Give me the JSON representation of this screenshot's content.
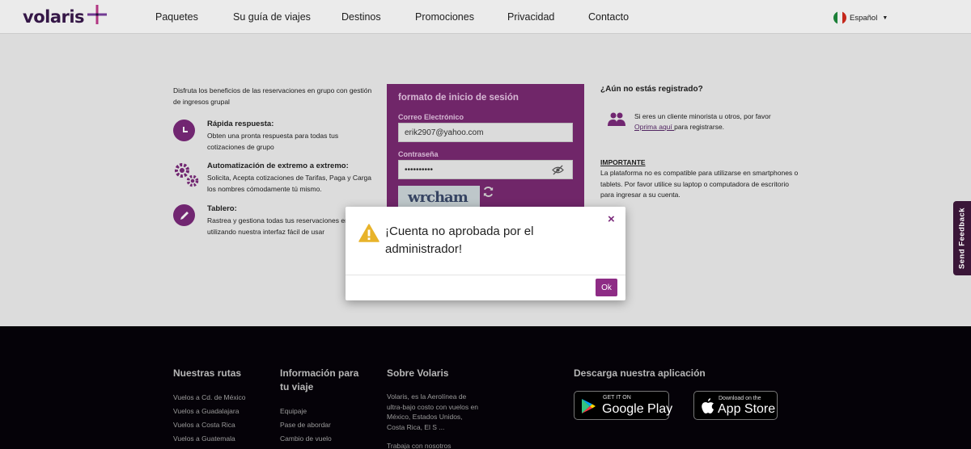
{
  "header": {
    "logo_text": "volaris",
    "nav": [
      "Paquetes",
      "Su guía de viajes",
      "Destinos",
      "Promociones",
      "Privacidad",
      "Contacto"
    ],
    "language": "Español"
  },
  "left": {
    "intro": "Disfruta los beneficios de las reservaciones en grupo con gestión de ingresos grupal",
    "benefits": [
      {
        "title": "Rápida respuesta:",
        "text": "Obten una pronta respuesta para todas tus cotizaciones de grupo",
        "icon": "clock-icon"
      },
      {
        "title": "Automatización de extremo a extremo:",
        "text": "Solicita, Acepta cotizaciones de Tarifas, Paga y Carga los nombres cómodamente tú mismo.",
        "icon": "gears-icon"
      },
      {
        "title": "Tablero:",
        "text": "Rastrea y gestiona todas tus reservaciones en grupo utilizando nuestra interfaz fácil de usar",
        "icon": "pencil-icon"
      }
    ]
  },
  "login": {
    "title": "formato de inicio de sesión",
    "email_label": "Correo Electrónico",
    "email_value": "erik2907@yahoo.com",
    "password_label": "Contraseña",
    "password_value": "••••••••••",
    "captcha_text": "wrcham"
  },
  "right": {
    "title": "¿Aún no estás registrado?",
    "text_before": "Si eres un cliente minorista u otros, por favor ",
    "link": "Oprima aquí ",
    "text_after": "para registrarse.",
    "important_title": "IMPORTANTE",
    "important_text": "La plataforma no es compatible para utilizarse en smartphones o tablets. Por favor utilice su laptop o computadora de escritorio para ingresar a su cuenta."
  },
  "feedback": "Send Feedback",
  "modal": {
    "message": "¡Cuenta no aprobada por el administrador!",
    "close": "×",
    "ok": "Ok"
  },
  "footer": {
    "routes_title": "Nuestras rutas",
    "routes": [
      "Vuelos a Cd. de México",
      "Vuelos a Guadalajara",
      "Vuelos a Costa Rica",
      "Vuelos a Guatemala"
    ],
    "info_title": "Información para tu viaje",
    "info": [
      "Equipaje",
      "Pase de abordar",
      "Cambio de vuelo"
    ],
    "about_title": "Sobre Volaris",
    "about_text": "Volaris, es la Aerolínea de ultra-bajo costo con vuelos en México, Estados Unidos, Costa Rica, El S ...",
    "about_link": "Trabaja con nosotros",
    "app_title": "Descarga nuestra aplicación",
    "google_small": "GET IT ON",
    "google_big": "Google Play",
    "apple_small": "Download on the",
    "apple_big": "App Store"
  }
}
